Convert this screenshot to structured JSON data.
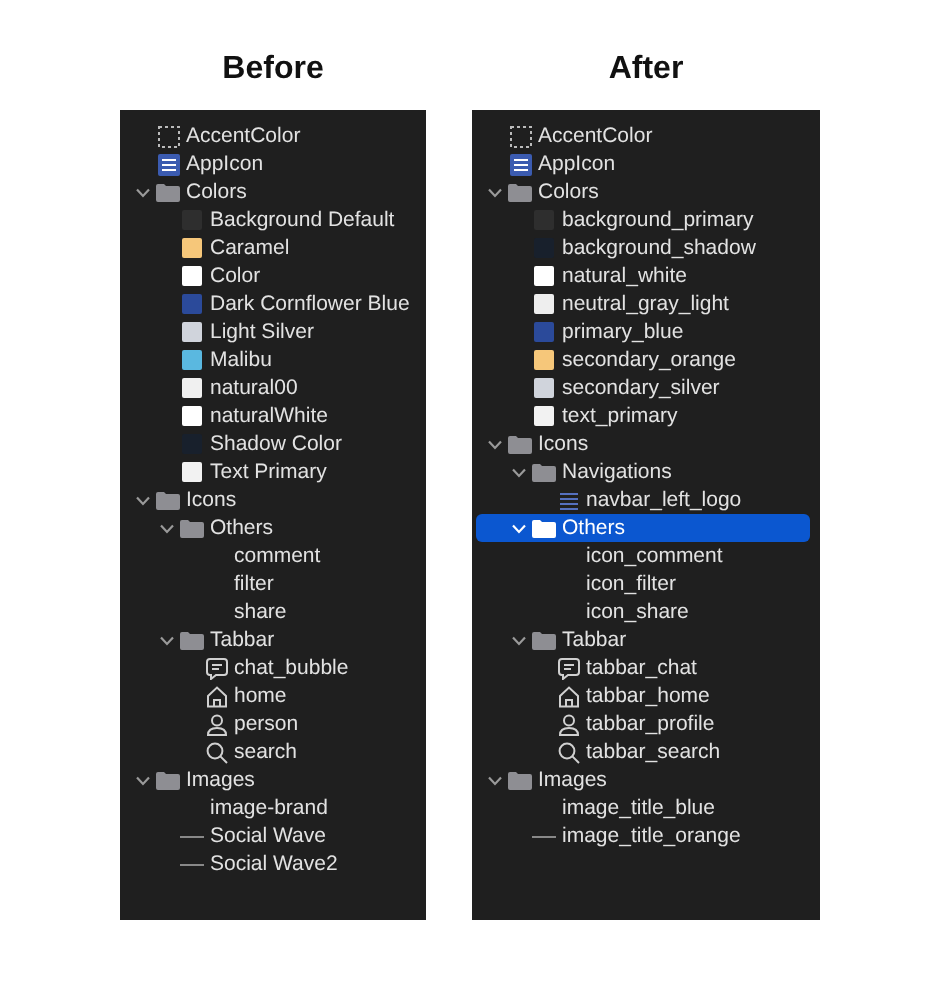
{
  "panels": [
    {
      "heading": "Before",
      "items": [
        {
          "label": "AccentColor",
          "kind": "accent",
          "selected": false
        },
        {
          "label": "AppIcon",
          "kind": "appicon",
          "selected": false
        },
        {
          "label": "Colors",
          "kind": "folder",
          "expanded": true,
          "selected": false,
          "children": [
            {
              "label": "Background Default",
              "kind": "swatch",
              "color": "#2e2e2e",
              "selected": false
            },
            {
              "label": "Caramel",
              "kind": "swatch",
              "color": "#f6c77a",
              "selected": false
            },
            {
              "label": "Color",
              "kind": "swatch",
              "color": "#ffffff",
              "selected": false
            },
            {
              "label": "Dark Cornflower Blue",
              "kind": "swatch",
              "color": "#2b4a9a",
              "selected": false
            },
            {
              "label": "Light Silver",
              "kind": "swatch",
              "color": "#d0d4dc",
              "selected": false
            },
            {
              "label": "Malibu",
              "kind": "swatch",
              "color": "#5ab8e0",
              "selected": false
            },
            {
              "label": "natural00",
              "kind": "swatch",
              "color": "#f0f0f0",
              "selected": false
            },
            {
              "label": "naturalWhite",
              "kind": "swatch",
              "color": "#ffffff",
              "selected": false
            },
            {
              "label": "Shadow Color",
              "kind": "swatch",
              "color": "#18202c",
              "selected": false
            },
            {
              "label": "Text Primary",
              "kind": "swatch",
              "color": "#f2f2f2",
              "selected": false
            }
          ]
        },
        {
          "label": "Icons",
          "kind": "folder",
          "expanded": true,
          "selected": false,
          "children": [
            {
              "label": "Others",
              "kind": "folder",
              "expanded": true,
              "selected": false,
              "children": [
                {
                  "label": "comment",
                  "kind": "plain",
                  "selected": false
                },
                {
                  "label": "filter",
                  "kind": "plain",
                  "selected": false
                },
                {
                  "label": "share",
                  "kind": "plain",
                  "selected": false
                }
              ]
            },
            {
              "label": "Tabbar",
              "kind": "folder",
              "expanded": true,
              "selected": false,
              "children": [
                {
                  "label": "chat_bubble",
                  "kind": "chat",
                  "selected": false
                },
                {
                  "label": "home",
                  "kind": "home",
                  "selected": false
                },
                {
                  "label": "person",
                  "kind": "person",
                  "selected": false
                },
                {
                  "label": "search",
                  "kind": "search",
                  "selected": false
                }
              ]
            }
          ]
        },
        {
          "label": "Images",
          "kind": "folder",
          "expanded": true,
          "selected": false,
          "children": [
            {
              "label": "image-brand",
              "kind": "plain",
              "selected": false
            },
            {
              "label": "Social Wave",
              "kind": "wave",
              "selected": false
            },
            {
              "label": "Social Wave2",
              "kind": "wave",
              "selected": false
            }
          ]
        }
      ]
    },
    {
      "heading": "After",
      "items": [
        {
          "label": "AccentColor",
          "kind": "accent",
          "selected": false
        },
        {
          "label": "AppIcon",
          "kind": "appicon",
          "selected": false
        },
        {
          "label": "Colors",
          "kind": "folder",
          "expanded": true,
          "selected": false,
          "children": [
            {
              "label": "background_primary",
              "kind": "swatch",
              "color": "#2e2e2e",
              "selected": false
            },
            {
              "label": "background_shadow",
              "kind": "swatch",
              "color": "#18202c",
              "selected": false
            },
            {
              "label": "natural_white",
              "kind": "swatch",
              "color": "#ffffff",
              "selected": false
            },
            {
              "label": "neutral_gray_light",
              "kind": "swatch",
              "color": "#eeeeee",
              "selected": false
            },
            {
              "label": "primary_blue",
              "kind": "swatch",
              "color": "#2b4a9a",
              "selected": false
            },
            {
              "label": "secondary_orange",
              "kind": "swatch",
              "color": "#f6c77a",
              "selected": false
            },
            {
              "label": "secondary_silver",
              "kind": "swatch",
              "color": "#d0d4dc",
              "selected": false
            },
            {
              "label": "text_primary",
              "kind": "swatch",
              "color": "#f2f2f2",
              "selected": false
            }
          ]
        },
        {
          "label": "Icons",
          "kind": "folder",
          "expanded": true,
          "selected": false,
          "children": [
            {
              "label": "Navigations",
              "kind": "folder",
              "expanded": true,
              "selected": false,
              "children": [
                {
                  "label": "navbar_left_logo",
                  "kind": "lines",
                  "selected": false
                }
              ]
            },
            {
              "label": "Others",
              "kind": "folder",
              "expanded": true,
              "selected": true,
              "children": [
                {
                  "label": "icon_comment",
                  "kind": "plain",
                  "selected": false
                },
                {
                  "label": "icon_filter",
                  "kind": "plain",
                  "selected": false
                },
                {
                  "label": "icon_share",
                  "kind": "plain",
                  "selected": false
                }
              ]
            },
            {
              "label": "Tabbar",
              "kind": "folder",
              "expanded": true,
              "selected": false,
              "children": [
                {
                  "label": "tabbar_chat",
                  "kind": "chat",
                  "selected": false
                },
                {
                  "label": "tabbar_home",
                  "kind": "home",
                  "selected": false
                },
                {
                  "label": "tabbar_profile",
                  "kind": "person",
                  "selected": false
                },
                {
                  "label": "tabbar_search",
                  "kind": "search",
                  "selected": false
                }
              ]
            }
          ]
        },
        {
          "label": "Images",
          "kind": "folder",
          "expanded": true,
          "selected": false,
          "children": [
            {
              "label": "image_title_blue",
              "kind": "plain",
              "selected": false
            },
            {
              "label": "image_title_orange",
              "kind": "wave",
              "selected": false
            }
          ]
        }
      ]
    }
  ]
}
